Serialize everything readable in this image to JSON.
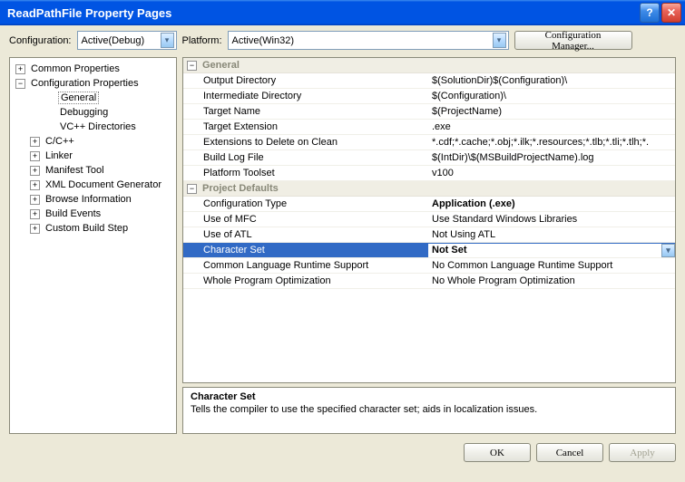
{
  "title": "ReadPathFile Property Pages",
  "top": {
    "config_label": "Configuration:",
    "config_value": "Active(Debug)",
    "platform_label": "Platform:",
    "platform_value": "Active(Win32)",
    "manager_button": "Configuration Manager..."
  },
  "tree": {
    "n0": "Common Properties",
    "n1": "Configuration Properties",
    "n1_0": "General",
    "n1_1": "Debugging",
    "n1_2": "VC++ Directories",
    "n1_3": "C/C++",
    "n1_4": "Linker",
    "n1_5": "Manifest Tool",
    "n1_6": "XML Document Generator",
    "n1_7": "Browse Information",
    "n1_8": "Build Events",
    "n1_9": "Custom Build Step"
  },
  "grid": {
    "section1": "General",
    "s1r0n": "Output Directory",
    "s1r0v": "$(SolutionDir)$(Configuration)\\",
    "s1r1n": "Intermediate Directory",
    "s1r1v": "$(Configuration)\\",
    "s1r2n": "Target Name",
    "s1r2v": "$(ProjectName)",
    "s1r3n": "Target Extension",
    "s1r3v": ".exe",
    "s1r4n": "Extensions to Delete on Clean",
    "s1r4v": "*.cdf;*.cache;*.obj;*.ilk;*.resources;*.tlb;*.tli;*.tlh;*.",
    "s1r5n": "Build Log File",
    "s1r5v": "$(IntDir)\\$(MSBuildProjectName).log",
    "s1r6n": "Platform Toolset",
    "s1r6v": "v100",
    "section2": "Project Defaults",
    "s2r0n": "Configuration Type",
    "s2r0v": "Application (.exe)",
    "s2r1n": "Use of MFC",
    "s2r1v": "Use Standard Windows Libraries",
    "s2r2n": "Use of ATL",
    "s2r2v": "Not Using ATL",
    "s2r3n": "Character Set",
    "s2r3v": "Not Set",
    "s2r4n": "Common Language Runtime Support",
    "s2r4v": "No Common Language Runtime Support",
    "s2r5n": "Whole Program Optimization",
    "s2r5v": "No Whole Program Optimization"
  },
  "desc": {
    "title": "Character Set",
    "text": "Tells the compiler to use the specified character set; aids in localization issues."
  },
  "buttons": {
    "ok": "OK",
    "cancel": "Cancel",
    "apply": "Apply"
  }
}
